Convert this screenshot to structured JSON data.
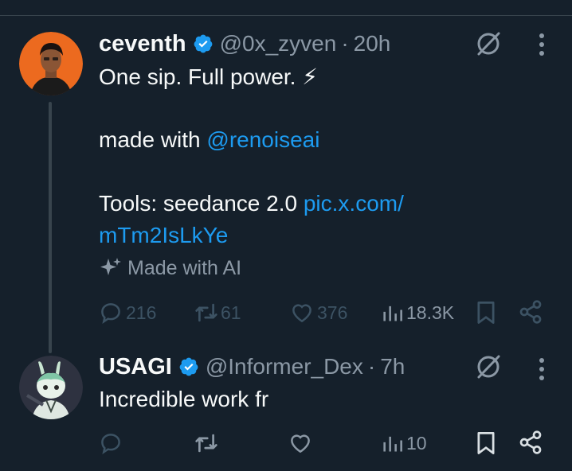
{
  "post": {
    "author_name": "ceventh",
    "handle": "@0x_zyven",
    "separator": "·",
    "time": "20h",
    "line1": "One sip. Full power. ⚡",
    "line2_prefix": "made with ",
    "line2_mention": "@renoiseai",
    "line3_prefix": "Tools: seedance 2.0 ",
    "line3_link": "pic.x.com/",
    "line4_link": "mTm2IsLkYe",
    "ai_label": "Made with AI",
    "replies": "216",
    "reposts": "61",
    "likes": "376",
    "views": "18.3K"
  },
  "reply": {
    "author_name": "USAGI",
    "handle": "@Informer_Dex",
    "separator": "·",
    "time": "7h",
    "text": "Incredible work fr",
    "views": "10"
  },
  "colors": {
    "background": "#15202b",
    "text": "#f7f9f9",
    "muted": "#8b98a5",
    "link": "#1d9bf0",
    "dim_action": "#3c5263"
  },
  "icons": [
    "verified-badge-icon",
    "grok-icon",
    "more-icon",
    "sparkle-icon",
    "reply-icon",
    "repost-icon",
    "like-icon",
    "views-icon",
    "bookmark-icon",
    "share-icon"
  ]
}
